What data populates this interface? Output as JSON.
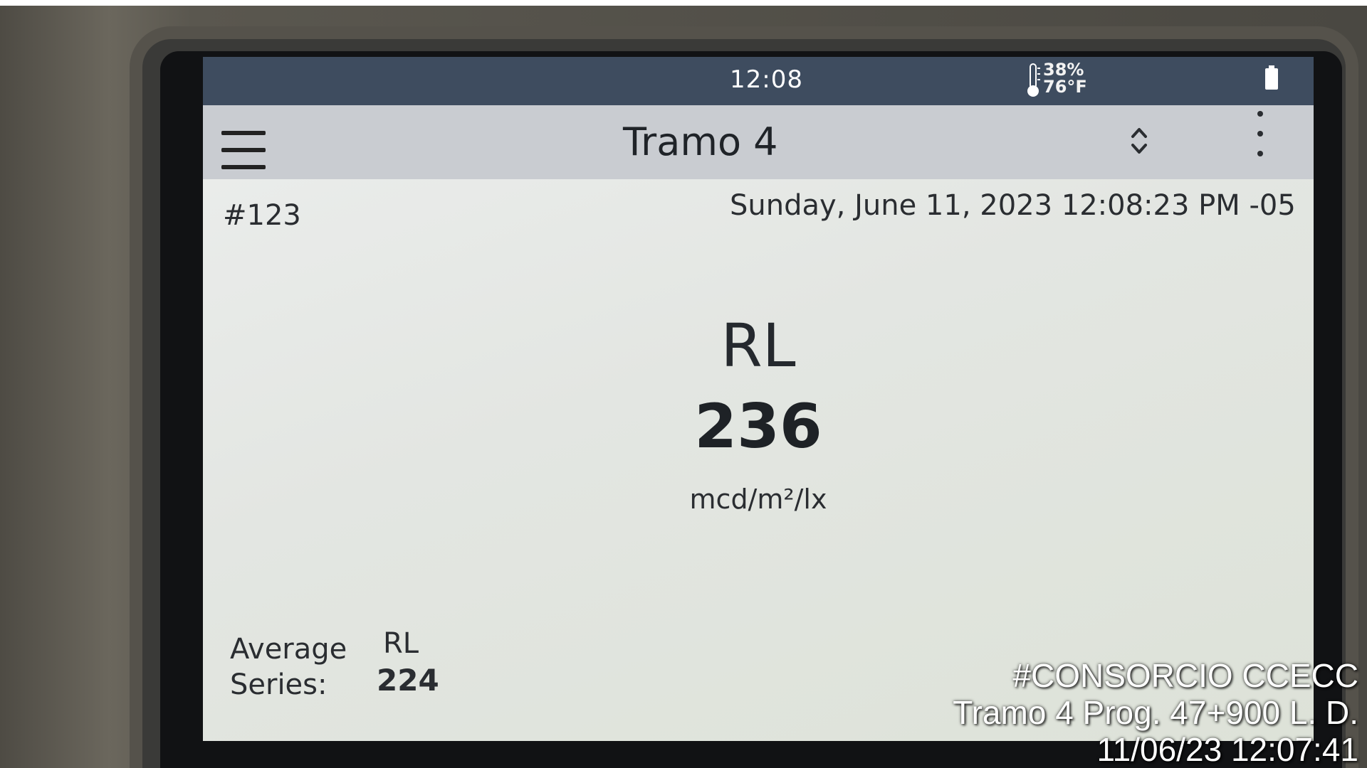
{
  "status_bar": {
    "time": "12:08",
    "humidity": "38%",
    "temperature": "76°F",
    "icons": [
      "thermometer-icon",
      "battery-icon"
    ]
  },
  "header": {
    "title": "Tramo 4",
    "icons": [
      "menu-icon",
      "up-down-icon",
      "more-vertical-icon"
    ]
  },
  "record": {
    "number": "#123",
    "datetime": "Sunday, June 11, 2023 12:08:23 PM -05"
  },
  "measurement": {
    "label": "RL",
    "value": "236",
    "unit": "mcd/m²/lx"
  },
  "average": {
    "label_line1": "Average",
    "label_line2": "Series:",
    "type": "RL",
    "value": "224"
  },
  "photo_watermark": {
    "line1": "#CONSORCIO CCECC",
    "line2": "Tramo 4 Prog. 47+900 L. D.",
    "line3": "11/06/23  12:07:41"
  },
  "colors": {
    "status_bar": "#3e4c5f",
    "title_bar": "#c9ccd1",
    "screen_bg": "#e3e6e2",
    "text": "#2a2d31"
  }
}
